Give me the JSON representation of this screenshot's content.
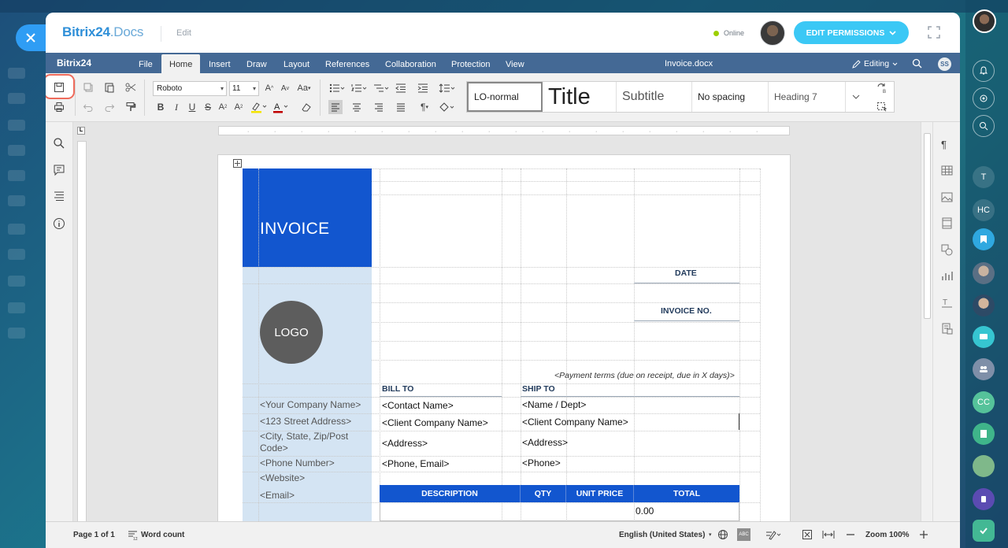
{
  "header": {
    "brand_main": "Bitrix",
    "brand_num": "24",
    "brand_suffix": ".Docs",
    "mode": "Edit",
    "status": "Online",
    "permissions_button": "EDIT PERMISSIONS"
  },
  "menubar": {
    "logo": "Bitrix24",
    "items": [
      "File",
      "Home",
      "Insert",
      "Draw",
      "Layout",
      "References",
      "Collaboration",
      "Protection",
      "View"
    ],
    "active": "Home",
    "document_name": "Invoice.docx",
    "editing_label": "Editing",
    "user_initials": "SS"
  },
  "toolbar": {
    "font_name": "Roboto",
    "font_size": "11",
    "styles": [
      "LO-normal",
      "Title",
      "Subtitle",
      "No spacing",
      "Heading 7"
    ]
  },
  "document": {
    "invoice_title": "INVOICE",
    "logo_text": "LOGO",
    "date_label": "DATE",
    "invoice_no_label": "INVOICE NO.",
    "payment_terms": "<Payment terms (due on receipt, due in X days)>",
    "bill_to": "BILL TO",
    "ship_to": "SHIP TO",
    "company": {
      "name": "<Your Company Name>",
      "street": "<123 Street Address>",
      "city_line1": "<City, State, Zip/Post",
      "city_line2": "Code>",
      "phone": "<Phone Number>",
      "website": "<Website>",
      "email": "<Email>"
    },
    "bill": {
      "contact": "<Contact Name>",
      "company": "<Client Company Name>",
      "address": "<Address>",
      "phone": "<Phone, Email>"
    },
    "ship": {
      "name": "<Name / Dept>",
      "company": "<Client Company Name>",
      "address": "<Address>",
      "phone": "<Phone>"
    },
    "table_headers": [
      "DESCRIPTION",
      "QTY",
      "UNIT PRICE",
      "TOTAL"
    ],
    "first_total": "0.00"
  },
  "statusbar": {
    "page": "Page 1 of 1",
    "word_count": "Word count",
    "language": "English (United States)",
    "zoom": "Zoom 100%"
  }
}
